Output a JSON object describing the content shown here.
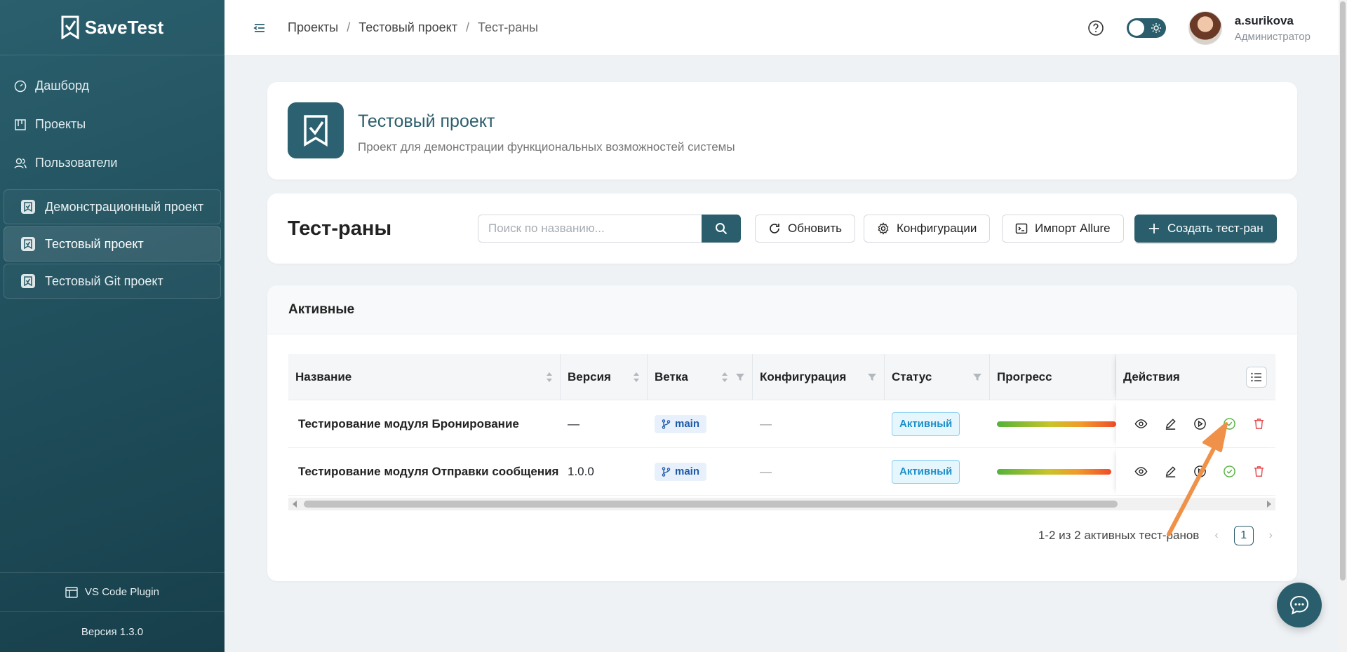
{
  "app": {
    "name": "SaveTest",
    "version_label": "Версия 1.3.0",
    "plugin_label": "VS Code Plugin"
  },
  "colors": {
    "brand": "#2a5e6c",
    "status_active": "#1d8fc9",
    "branch": "#1e5aa8",
    "annotation_arrow": "#f0914a"
  },
  "sidebar": {
    "nav": [
      {
        "label": "Дашборд",
        "icon": "dashboard-icon"
      },
      {
        "label": "Проекты",
        "icon": "projects-icon"
      },
      {
        "label": "Пользователи",
        "icon": "users-icon"
      }
    ],
    "projects": [
      {
        "label": "Демонстрационный проект",
        "active": false
      },
      {
        "label": "Тестовый проект",
        "active": true
      },
      {
        "label": "Тестовый Git проект",
        "active": false
      }
    ]
  },
  "header": {
    "breadcrumbs": [
      "Проекты",
      "Тестовый проект",
      "Тест-раны"
    ],
    "user": {
      "name": "a.surikova",
      "role": "Администратор"
    }
  },
  "project": {
    "title": "Тестовый проект",
    "description": "Проект для демонстрации функциональных возможностей системы"
  },
  "toolbar": {
    "title": "Тест-раны",
    "search_placeholder": "Поиск по названию...",
    "refresh_label": "Обновить",
    "config_label": "Конфигурации",
    "import_label": "Импорт Allure",
    "create_label": "Создать тест-ран"
  },
  "table": {
    "section_title": "Активные",
    "columns": [
      "Название",
      "Версия",
      "Ветка",
      "Конфигурация",
      "Статус",
      "Прогресс",
      "Действия"
    ],
    "rows": [
      {
        "name": "Тестирование модуля Бронирование",
        "version": "—",
        "branch": "main",
        "config": "—",
        "status": "Активный",
        "progress_pct": 100
      },
      {
        "name": "Тестирование модуля Отправки сообщения",
        "version": "1.0.0",
        "branch": "main",
        "config": "—",
        "status": "Активный",
        "progress_pct": 100
      }
    ],
    "pagination": {
      "summary": "1-2 из 2 активных тест-ранов",
      "current_page": "1"
    }
  }
}
